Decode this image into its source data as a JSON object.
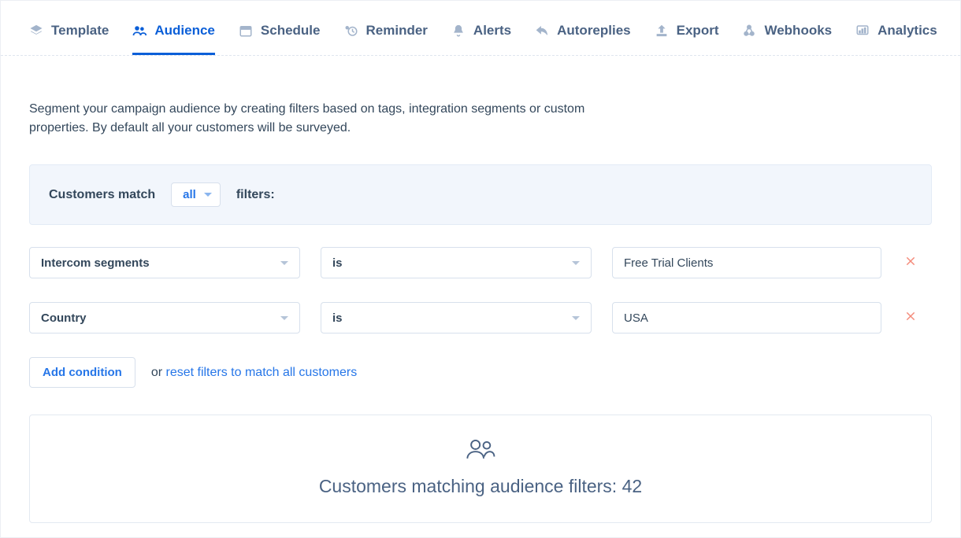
{
  "tabs": [
    {
      "id": "template",
      "label": "Template"
    },
    {
      "id": "audience",
      "label": "Audience"
    },
    {
      "id": "schedule",
      "label": "Schedule"
    },
    {
      "id": "reminder",
      "label": "Reminder"
    },
    {
      "id": "alerts",
      "label": "Alerts"
    },
    {
      "id": "autoreplies",
      "label": "Autoreplies"
    },
    {
      "id": "export",
      "label": "Export"
    },
    {
      "id": "webhooks",
      "label": "Webhooks"
    },
    {
      "id": "analytics",
      "label": "Analytics"
    }
  ],
  "active_tab": "audience",
  "description": "Segment your campaign audience by creating filters based on tags, integration segments or custom properties. By default all your customers will be surveyed.",
  "match_bar": {
    "prefix": "Customers match",
    "mode": "all",
    "suffix": "filters:"
  },
  "filters": [
    {
      "attribute": "Intercom segments",
      "operator": "is",
      "value": "Free Trial Clients"
    },
    {
      "attribute": "Country",
      "operator": "is",
      "value": "USA"
    }
  ],
  "add_condition_label": "Add condition",
  "reset_prefix": "or ",
  "reset_link": "reset filters to match all customers",
  "result": {
    "label_prefix": "Customers matching audience filters: ",
    "count": "42"
  }
}
